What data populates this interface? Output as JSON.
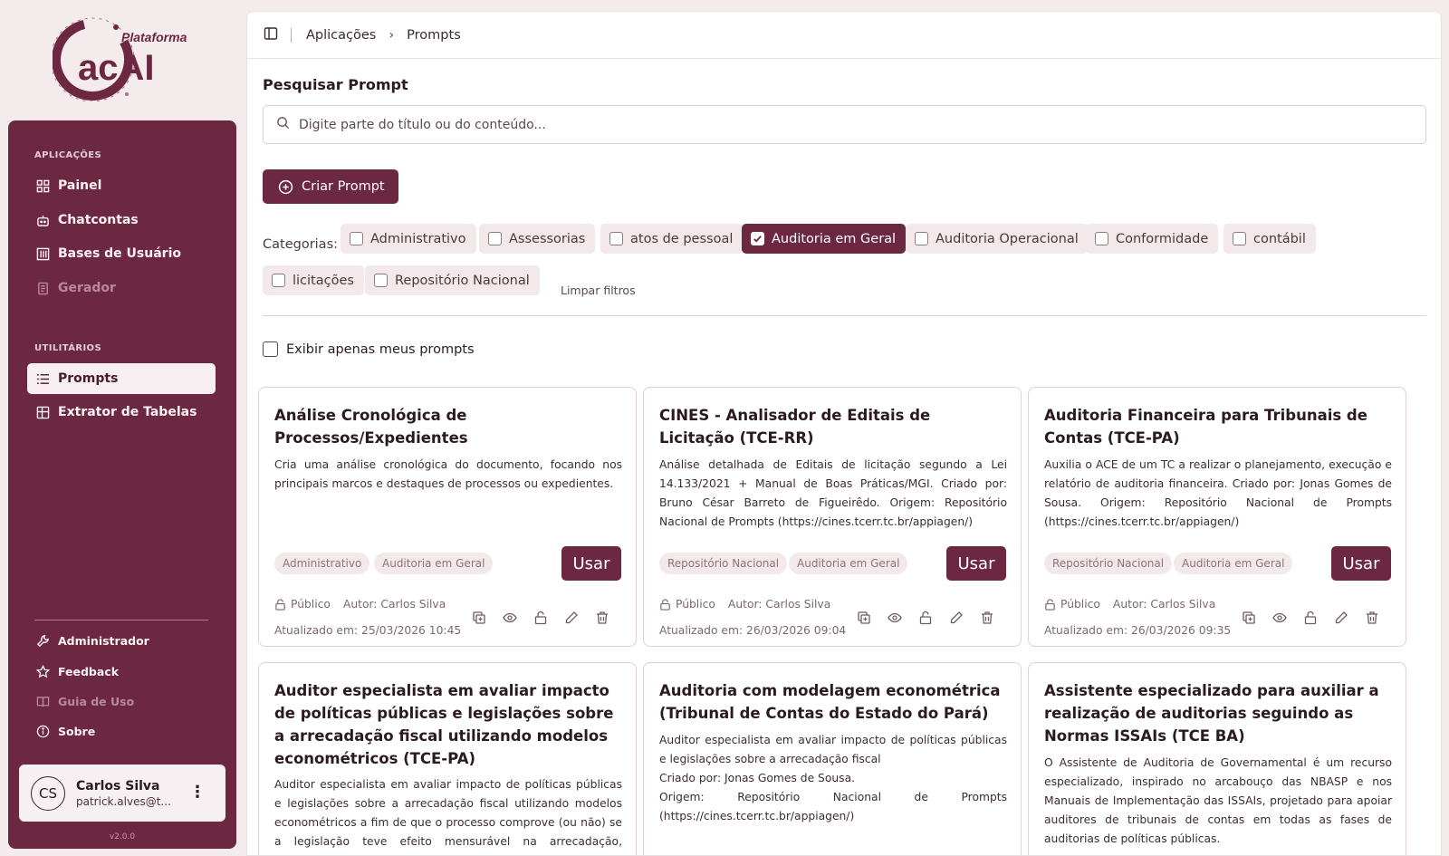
{
  "logo": {
    "text_top": "Plataforma",
    "text_main": "acAI"
  },
  "sidebar": {
    "section_apps": "APLICAÇÕES",
    "section_utils": "UTILITÁRIOS",
    "apps": [
      {
        "label": "Painel",
        "icon": "grid-icon"
      },
      {
        "label": "Chatcontas",
        "icon": "bot-icon"
      },
      {
        "label": "Bases de Usuário",
        "icon": "library-icon"
      },
      {
        "label": "Gerador",
        "icon": "document-icon"
      }
    ],
    "utils": [
      {
        "label": "Prompts",
        "icon": "list-icon"
      },
      {
        "label": "Extrator de Tabelas",
        "icon": "table-icon"
      }
    ],
    "bottom": [
      {
        "label": "Administrador",
        "icon": "wrench-icon"
      },
      {
        "label": "Feedback",
        "icon": "star-icon"
      },
      {
        "label": "Guia de Uso",
        "icon": "book-icon"
      },
      {
        "label": "Sobre",
        "icon": "info-icon"
      }
    ],
    "user": {
      "initials": "CS",
      "name": "Carlos Silva",
      "email": "patrick.alves@t..."
    },
    "version": "v2.0.0"
  },
  "topbar": {
    "breadcrumb": [
      "Aplicações",
      "Prompts"
    ]
  },
  "search": {
    "title": "Pesquisar Prompt",
    "placeholder": "Digite parte do título ou do conteúdo..."
  },
  "create_label": "Criar Prompt",
  "filters": {
    "label": "Categorias:",
    "chips": [
      {
        "label": "Administrativo",
        "checked": false
      },
      {
        "label": "Assessorias",
        "checked": false
      },
      {
        "label": "atos de pessoal",
        "checked": false
      },
      {
        "label": "Auditoria em Geral",
        "checked": true
      },
      {
        "label": "Auditoria Operacional",
        "checked": false
      },
      {
        "label": "Conformidade",
        "checked": false
      },
      {
        "label": "contábil",
        "checked": false
      },
      {
        "label": "licitações",
        "checked": false
      },
      {
        "label": "Repositório Nacional",
        "checked": false
      }
    ],
    "clear": "Limpar filtros",
    "mine": "Exibir apenas meus prompts"
  },
  "cards": [
    {
      "title": "Análise Cronológica de Processos/Expedientes",
      "description": "Cria uma análise cronológica do documento, focando nos principais marcos e destaques de processos ou expedientes.",
      "tags": [
        "Administrativo",
        "Auditoria em Geral"
      ],
      "use": "Usar",
      "visibility": "Público",
      "author": "Autor: Carlos Silva",
      "updated": "Atualizado em: 25/03/2026 10:45"
    },
    {
      "title": "CINES - Analisador de Editais de Licitação (TCE-RR)",
      "description": "Análise detalhada de Editais de licitação segundo a Lei 14.133/2021 + Manual de Boas Práticas/MGI. Criado por: Bruno César Barreto de Figueirêdo. Origem: Repositório Nacional de Prompts (https://cines.tcerr.tc.br/appiagen/)",
      "tags": [
        "Repositório Nacional",
        "Auditoria em Geral"
      ],
      "use": "Usar",
      "visibility": "Público",
      "author": "Autor: Carlos Silva",
      "updated": "Atualizado em: 26/03/2026 09:04"
    },
    {
      "title": "Auditoria Financeira para Tribunais de Contas (TCE-PA)",
      "description": "Auxilia o ACE de um TC a realizar o planejamento, execução e relatório de auditoria financeira. Criado por: Jonas Gomes de Sousa. Origem: Repositório Nacional de Prompts (https://cines.tcerr.tc.br/appiagen/)",
      "tags": [
        "Repositório Nacional",
        "Auditoria em Geral"
      ],
      "use": "Usar",
      "visibility": "Público",
      "author": "Autor: Carlos Silva",
      "updated": "Atualizado em: 26/03/2026 09:35"
    },
    {
      "title": "Auditor especialista em avaliar impacto de políticas públicas e legislações sobre a arrecadação fiscal utilizando modelos econométricos (TCE-PA)",
      "description": "Auditor especialista em avaliar impacto de políticas públicas e legislações sobre a arrecadação fiscal utilizando modelos econométricos a fim de que o processo comprove (ou não) se a legislação teve efeito mensurável na arrecadação, auxiliando"
    },
    {
      "title": "Auditoria com modelagem econométrica (Tribunal de Contas do Estado do Pará)",
      "description_lines": [
        "Auditor especialista em avaliar impacto de políticas públicas e legislações sobre a arrecadação fiscal",
        "Criado por: Jonas Gomes de Sousa.",
        "Origem: Repositório Nacional de Prompts (https://cines.tcerr.tc.br/appiagen/)"
      ]
    },
    {
      "title": "Assistente especializado para auxiliar a realização de auditorias seguindo as Normas ISSAIs (TCE BA)",
      "description": "O Assistente de Auditoria de Governamental é um recurso especializado, inspirado no arcabouço das NBASP e nos Manuais de Implementação das ISSAIs, projetado para apoiar auditores de tribunais de contas em todas as fases de auditorias de políticas públicas."
    }
  ],
  "colors": {
    "brand": "#6b2840",
    "background": "#f3ebec",
    "chip": "#f3e8ea"
  }
}
